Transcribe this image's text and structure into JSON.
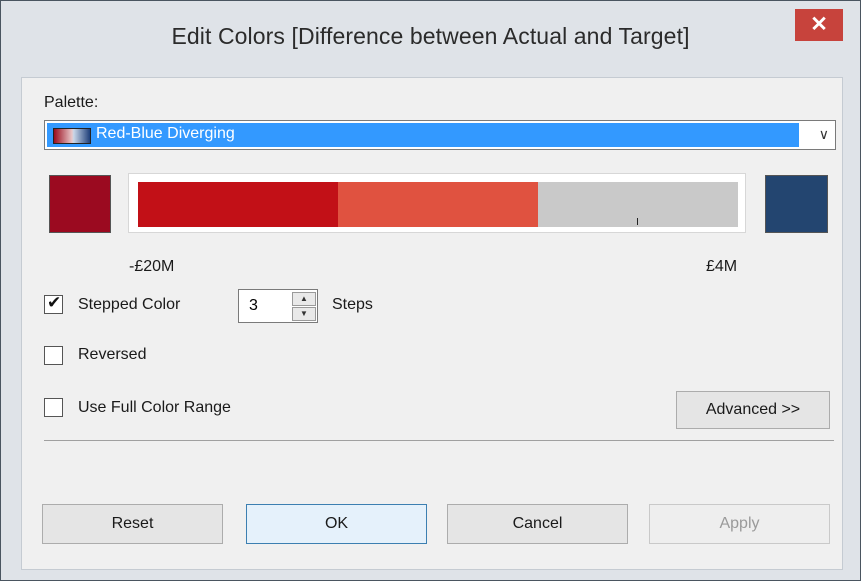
{
  "window": {
    "title": "Edit Colors [Difference between Actual and Target]",
    "close_glyph": "✕"
  },
  "palette": {
    "label": "Palette:",
    "selected": "Red-Blue Diverging",
    "dropdown_icon": "chevron-down-icon"
  },
  "colors": {
    "start": "#9b0a20",
    "end": "#234570",
    "ramp": [
      "#c21017",
      "#e05240",
      "#c9c9c9"
    ]
  },
  "range": {
    "min_label": "-£20M",
    "max_label": "£4M"
  },
  "stepped": {
    "label": "Stepped Color",
    "checked": true,
    "steps_value": "3",
    "steps_label": "Steps"
  },
  "reversed": {
    "label": "Reversed",
    "checked": false
  },
  "full_range": {
    "label": "Use Full Color Range",
    "checked": false
  },
  "buttons": {
    "advanced": "Advanced >>",
    "reset": "Reset",
    "ok": "OK",
    "cancel": "Cancel",
    "apply": "Apply"
  }
}
